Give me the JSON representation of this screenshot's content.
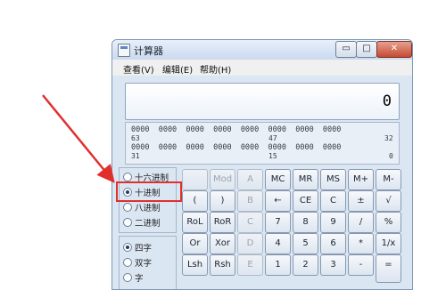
{
  "window": {
    "title": "计算器",
    "controls": {
      "minimize": "▭",
      "maximize": "□",
      "close": "✕"
    }
  },
  "menu": [
    "查看(V)",
    "编辑(E)",
    "帮助(H)"
  ],
  "display": {
    "value": "0"
  },
  "bits": {
    "row1": "0000  0000  0000  0000  0000  0000  0000  0000",
    "row1_labels": [
      "63",
      "47",
      "32"
    ],
    "row2": "0000  0000  0000  0000  0000  0000  0000  0000",
    "row2_labels": [
      "31",
      "15",
      "0"
    ]
  },
  "base_options": [
    {
      "label": "十六进制",
      "selected": false
    },
    {
      "label": "十进制",
      "selected": true
    },
    {
      "label": "八进制",
      "selected": false
    },
    {
      "label": "二进制",
      "selected": false
    }
  ],
  "word_options": [
    {
      "label": "四字",
      "selected": true
    },
    {
      "label": "双字",
      "selected": false
    },
    {
      "label": "字",
      "selected": false
    }
  ],
  "keys": [
    [
      "",
      "Mod",
      "A",
      "MC",
      "MR",
      "MS",
      "M+",
      "M-"
    ],
    [
      "(",
      ")",
      "B",
      "←",
      "CE",
      "C",
      "±",
      "√"
    ],
    [
      "RoL",
      "RoR",
      "C",
      "7",
      "8",
      "9",
      "/",
      "%"
    ],
    [
      "Or",
      "Xor",
      "D",
      "4",
      "5",
      "6",
      "*",
      "1/x"
    ],
    [
      "Lsh",
      "Rsh",
      "E",
      "1",
      "2",
      "3",
      "-",
      "="
    ]
  ],
  "colors": {
    "highlight": "#e0302e",
    "window_bg": "#dbe6f3"
  }
}
